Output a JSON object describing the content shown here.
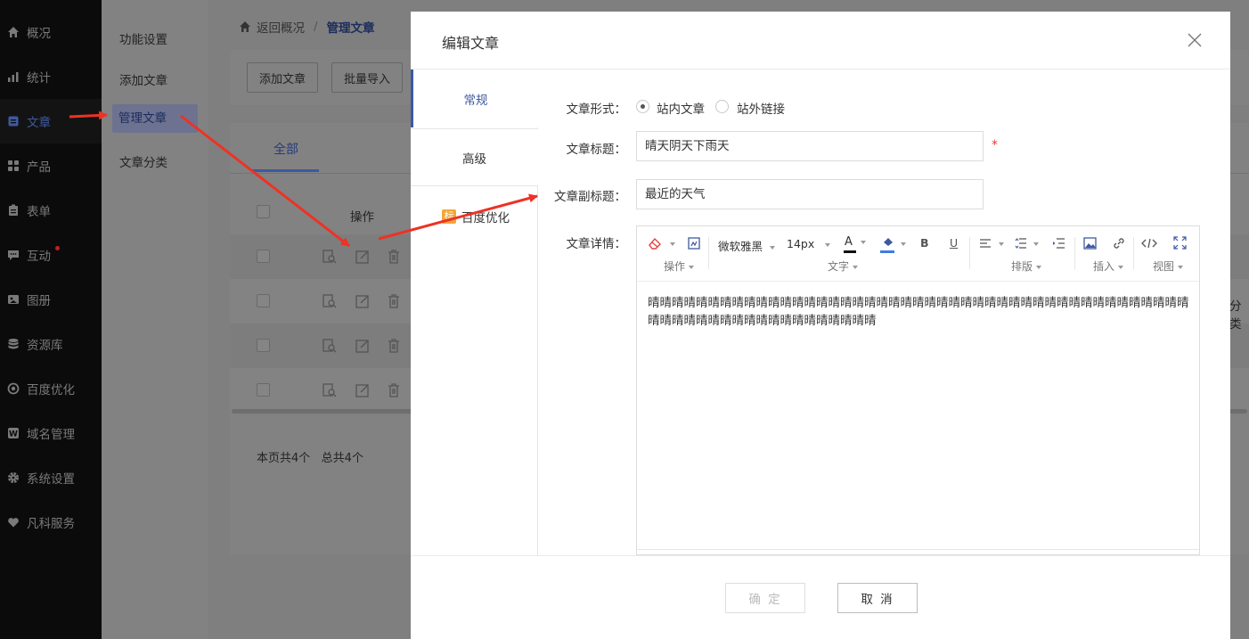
{
  "nav": {
    "items": [
      {
        "label": "概况",
        "icon": "home-icon"
      },
      {
        "label": "统计",
        "icon": "chart-icon"
      },
      {
        "label": "文章",
        "icon": "article-icon"
      },
      {
        "label": "产品",
        "icon": "grid-icon"
      },
      {
        "label": "表单",
        "icon": "clipboard-icon"
      },
      {
        "label": "互动",
        "icon": "chat-icon"
      },
      {
        "label": "图册",
        "icon": "gallery-icon"
      },
      {
        "label": "资源库",
        "icon": "database-icon"
      },
      {
        "label": "百度优化",
        "icon": "target-icon"
      },
      {
        "label": "域名管理",
        "icon": "domain-icon"
      },
      {
        "label": "系统设置",
        "icon": "gear-icon"
      },
      {
        "label": "凡科服务",
        "icon": "heart-icon"
      }
    ],
    "active": "文章"
  },
  "subnav": {
    "items": [
      "功能设置",
      "添加文章",
      "管理文章",
      "文章分类"
    ],
    "active": "管理文章"
  },
  "page": {
    "breadcrumb_back": "返回概况",
    "breadcrumb_sep": "/",
    "breadcrumb_current": "管理文章",
    "add_button": "添加文章",
    "import_button": "批量导入",
    "tab_all": "全部",
    "col_action": "操作",
    "summary": "本页共4个   总共4个",
    "edge_text": "分类"
  },
  "modal": {
    "title": "编辑文章",
    "tabs": {
      "general": "常规",
      "advanced": "高级",
      "seo": "百度优化",
      "seo_badge": "标"
    },
    "form": {
      "type_label": "文章形式：",
      "type_option_internal": "站内文章",
      "type_option_external": "站外链接",
      "title_label": "文章标题：",
      "title_value": "晴天阴天下雨天",
      "required_mark": "*",
      "subtitle_label": "文章副标题：",
      "subtitle_value": "最近的天气",
      "detail_label": "文章详情："
    },
    "editor": {
      "font_family": "微软雅黑",
      "font_size": "14px",
      "bold": "B",
      "underline": "U",
      "font_color": "A",
      "groups": {
        "operate": "操作",
        "text": "文字",
        "layout": "排版",
        "insert": "插入",
        "view": "视图"
      },
      "content": "晴晴晴晴晴晴晴晴晴晴晴晴晴晴晴晴晴晴晴晴晴晴晴晴晴晴晴晴晴晴晴晴晴晴晴晴晴晴晴晴晴晴晴晴晴晴晴晴晴晴晴晴晴晴晴晴晴晴晴晴晴晴晴晴"
    },
    "buttons": {
      "confirm": "确 定",
      "cancel": "取 消"
    }
  },
  "colors": {
    "accent": "#3e59a0",
    "arrow": "#ee3224",
    "required": "#e03b3b"
  }
}
